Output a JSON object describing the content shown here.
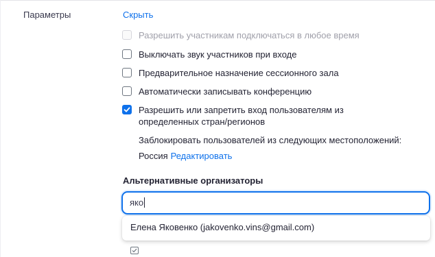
{
  "section": {
    "label": "Параметры",
    "hide_link": "Скрыть"
  },
  "options": [
    {
      "label": "Разрешить участникам подключаться в любое время",
      "checked": false,
      "disabled": true
    },
    {
      "label": "Выключать звук участников при входе",
      "checked": false,
      "disabled": false
    },
    {
      "label": "Предварительное назначение сессионного зала",
      "checked": false,
      "disabled": false
    },
    {
      "label": "Автоматически записывать конференцию",
      "checked": false,
      "disabled": false
    },
    {
      "label_line1": "Разрешить или запретить вход пользователям из",
      "label_line2": "определенных стран/регионов",
      "checked": true,
      "disabled": false
    }
  ],
  "region_block": {
    "description": "Заблокировать пользователей из следующих местоположений:",
    "country": "Россия",
    "edit_link": "Редактировать"
  },
  "alt_hosts": {
    "label": "Альтернативные организаторы",
    "search_value": "яко",
    "suggestion": "Елена Яковенко (jakovenko.vins@gmail.com)"
  },
  "colors": {
    "accent": "#0e71eb",
    "text": "#232333",
    "disabled_text": "#a0a0aa"
  }
}
